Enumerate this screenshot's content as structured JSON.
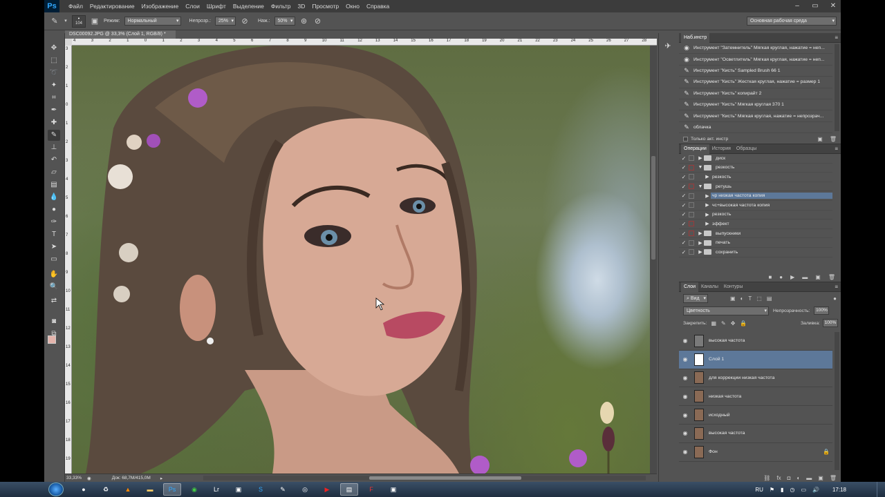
{
  "app": {
    "logo": "Ps",
    "menu": [
      "Файл",
      "Редактирование",
      "Изображение",
      "Слои",
      "Шрифт",
      "Выделение",
      "Фильтр",
      "3D",
      "Просмотр",
      "Окно",
      "Справка"
    ]
  },
  "options": {
    "brush_size": "104",
    "mode_label": "Режим:",
    "mode_value": "Нормальный",
    "opacity_label": "Непрозр.:",
    "opacity_value": "25%",
    "pressure_label": "Наж.:",
    "pressure_value": "50%",
    "workspace": "Основная рабочая среда"
  },
  "document": {
    "tab_title": "DSC00092.JPG @ 33,3% (Слой 1, RGB/8) *",
    "ruler_top": [
      "4",
      "3",
      "2",
      "1",
      "0",
      "1",
      "2",
      "3",
      "4",
      "5",
      "6",
      "7",
      "8",
      "9",
      "10",
      "11",
      "12",
      "13",
      "14",
      "15",
      "16",
      "17",
      "18",
      "19",
      "20",
      "21",
      "22",
      "23",
      "24",
      "25",
      "26",
      "27",
      "28"
    ],
    "ruler_left": [
      "3",
      "2",
      "1",
      "0",
      "1",
      "2",
      "3",
      "4",
      "5",
      "6",
      "7",
      "8",
      "9",
      "10",
      "11",
      "12",
      "13",
      "14",
      "15",
      "16",
      "17",
      "18",
      "19"
    ],
    "zoom": "33,33%",
    "doc_size": "Док: 68,7M/415,0M"
  },
  "tool_presets": {
    "title": "Наб.инстр",
    "items": [
      "Инструмент \"Затемнитель\" Мягкая круглая, нажатие = неп...",
      "Инструмент \"Осветлитель\" Мягкая круглая, нажатие = неп...",
      "Инструмент \"Кисть\" Sampled Brush 66 1",
      "Инструмент \"Кисть\" Жесткая круглая, нажатие = размер 1",
      "Инструмент \"Кисть\" копирайт 2",
      "Инструмент \"Кисть\" Мягкая круглая 370 1",
      "Инструмент \"Кисть\" Мягкая круглая, нажатие = непрозрач...",
      "облачка"
    ],
    "current_only": "Только акт. инстр"
  },
  "actions_panel": {
    "tabs": [
      "Операции",
      "История",
      "Образцы"
    ],
    "rows": [
      {
        "label": "диск",
        "indent": 0,
        "expanded": false,
        "red": false,
        "selected": false
      },
      {
        "label": "резкость",
        "indent": 0,
        "expanded": true,
        "red": true,
        "selected": false
      },
      {
        "label": "резкость",
        "indent": 1,
        "expanded": false,
        "red": false,
        "selected": false
      },
      {
        "label": "ретушь",
        "indent": 0,
        "expanded": true,
        "red": true,
        "selected": false
      },
      {
        "label": "чр низкая частота копия",
        "indent": 1,
        "expanded": false,
        "red": false,
        "selected": true
      },
      {
        "label": "чс+высокая частота копия",
        "indent": 1,
        "expanded": false,
        "red": false,
        "selected": false
      },
      {
        "label": "резкость",
        "indent": 1,
        "expanded": false,
        "red": false,
        "selected": false
      },
      {
        "label": "эффект",
        "indent": 1,
        "expanded": false,
        "red": true,
        "selected": false
      },
      {
        "label": "выпускники",
        "indent": 0,
        "expanded": false,
        "red": true,
        "selected": false
      },
      {
        "label": "печать",
        "indent": 0,
        "expanded": false,
        "red": false,
        "selected": false
      },
      {
        "label": "сохранить",
        "indent": 0,
        "expanded": false,
        "red": false,
        "selected": false
      }
    ]
  },
  "layers_panel": {
    "tabs": [
      "Слои",
      "Каналы",
      "Контуры"
    ],
    "kind": "Вид",
    "blend_mode": "Цветность",
    "opacity_label": "Непрозрачность:",
    "opacity_value": "100%",
    "lock_label": "Закрепить:",
    "fill_label": "Заливка:",
    "fill_value": "100%",
    "layers": [
      {
        "name": "высокая частота",
        "thumb": "#7a7a7a",
        "selected": false,
        "locked": false
      },
      {
        "name": "Слой 1",
        "thumb": "#ffffff",
        "selected": true,
        "locked": false
      },
      {
        "name": "для коррекции низкая частота",
        "thumb": "#8a6a55",
        "selected": false,
        "locked": false
      },
      {
        "name": "низкая частота",
        "thumb": "#8a6a55",
        "selected": false,
        "locked": false
      },
      {
        "name": "исходный",
        "thumb": "#8a6a55",
        "selected": false,
        "locked": false
      },
      {
        "name": "высокая частота",
        "thumb": "#8a6a55",
        "selected": false,
        "locked": false
      },
      {
        "name": "Фон",
        "thumb": "#8a6a55",
        "selected": false,
        "locked": true
      }
    ]
  },
  "taskbar": {
    "lang": "RU",
    "time": "17:18"
  },
  "colors": {
    "foreground": "#e4b4ac",
    "background": "#000000",
    "selection": "#5d7899"
  }
}
